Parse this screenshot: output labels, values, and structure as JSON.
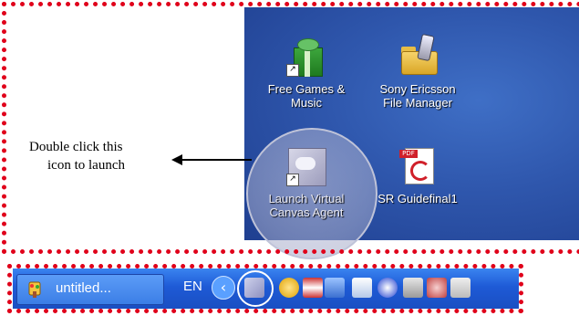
{
  "desktop": {
    "icons": [
      {
        "label_line1": "Free Games &",
        "label_line2": "Music",
        "icon": "gift-icon"
      },
      {
        "label_line1": "Sony Ericsson",
        "label_line2": "File Manager",
        "icon": "folder-phone-icon"
      },
      {
        "label_line1": "Launch Virtual",
        "label_line2": "Canvas Agent",
        "icon": "virtual-canvas-icon"
      },
      {
        "label_line1": "SR Guidefinal1",
        "label_line2": "",
        "icon": "pdf-icon"
      }
    ]
  },
  "annotation": {
    "line1": "Double click this",
    "line2": "icon to launch"
  },
  "taskbar": {
    "task_label": "untitled...",
    "language": "EN",
    "chevron": "‹"
  },
  "colors": {
    "highlight_frame": "#e0001a",
    "taskbar": "#1e5ad6",
    "desktop": "#2f57ad"
  }
}
